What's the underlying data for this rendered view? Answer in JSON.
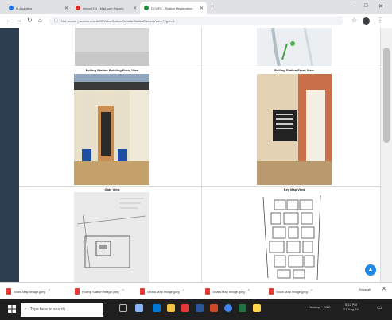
{
  "browser": {
    "tabs": [
      {
        "label": "In Analytics",
        "color": "#1a73e8"
      },
      {
        "label": "Inbox (15) - Mail.com (Nyoni)",
        "color": "#d93025"
      },
      {
        "label": "DCUFC - Station Registration",
        "color": "#1e8e3e"
      }
    ],
    "new_tab": "+",
    "window_controls": {
      "minimize": "–",
      "maximize": "□",
      "close": "✕"
    },
    "address": "Not secure  | acsmis.edu.in/GE/ViewStation/Details/StationCamera/View?Type=3"
  },
  "page": {
    "sections": [
      {
        "caption": "Polling Station Building Front View"
      },
      {
        "caption": "Polling Station Front View"
      },
      {
        "caption": "Gate View"
      },
      {
        "caption": "Key Map View"
      }
    ],
    "fab_icon": "arrow-up"
  },
  "downloads": {
    "items": [
      "Show Map Image.jpeg",
      "Polling Station Image.jpeg",
      "Ghata Map Image.jpeg",
      "Ghata Map Image.jpeg",
      "Show Map Image.jpeg"
    ],
    "show_all": "Show all"
  },
  "taskbar": {
    "search_placeholder": "Type here to search",
    "tray": "Desktop  ^  ENG",
    "time": "5:12 PM",
    "date": "27-Aug-19"
  }
}
